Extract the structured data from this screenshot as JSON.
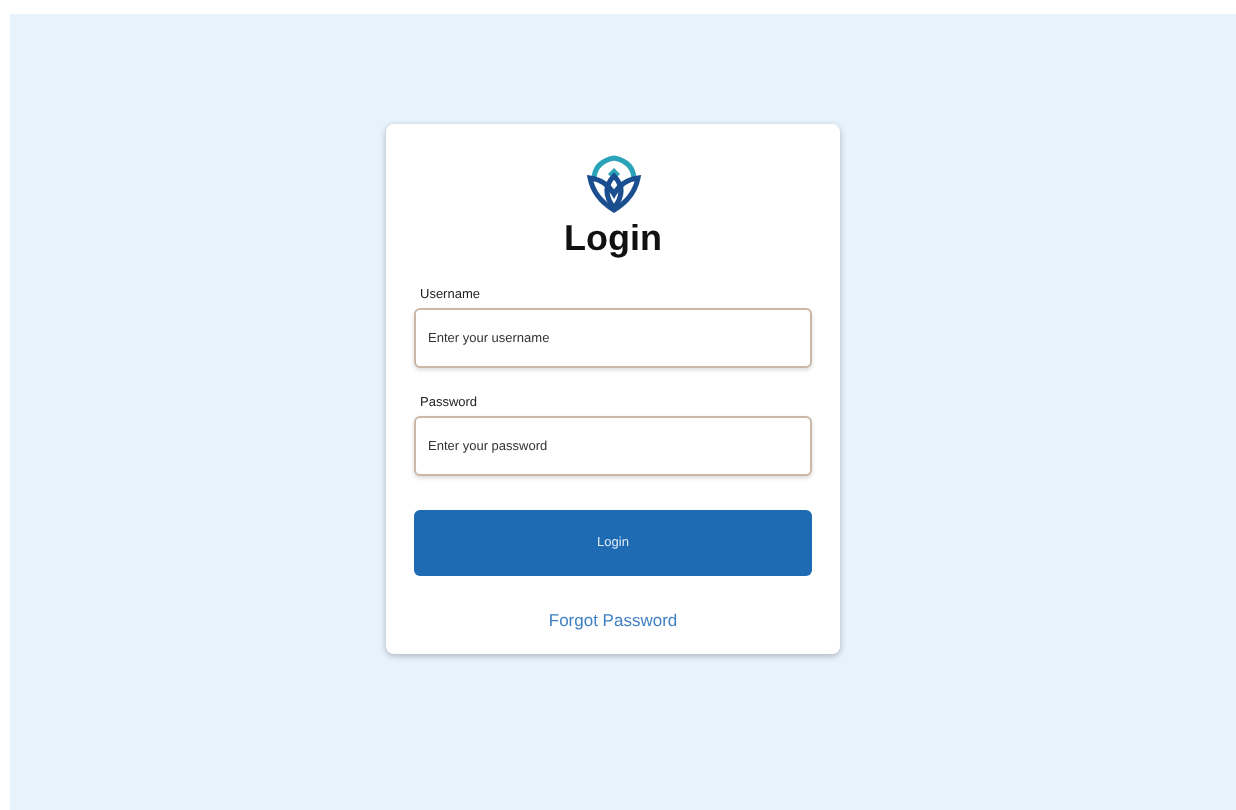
{
  "title": "Login",
  "fields": [
    {
      "label": "Username",
      "placeholder": "Enter your username"
    },
    {
      "label": "Password",
      "placeholder": "Enter your password"
    }
  ],
  "submit": "Login",
  "forgot_link": "Forgot Password"
}
